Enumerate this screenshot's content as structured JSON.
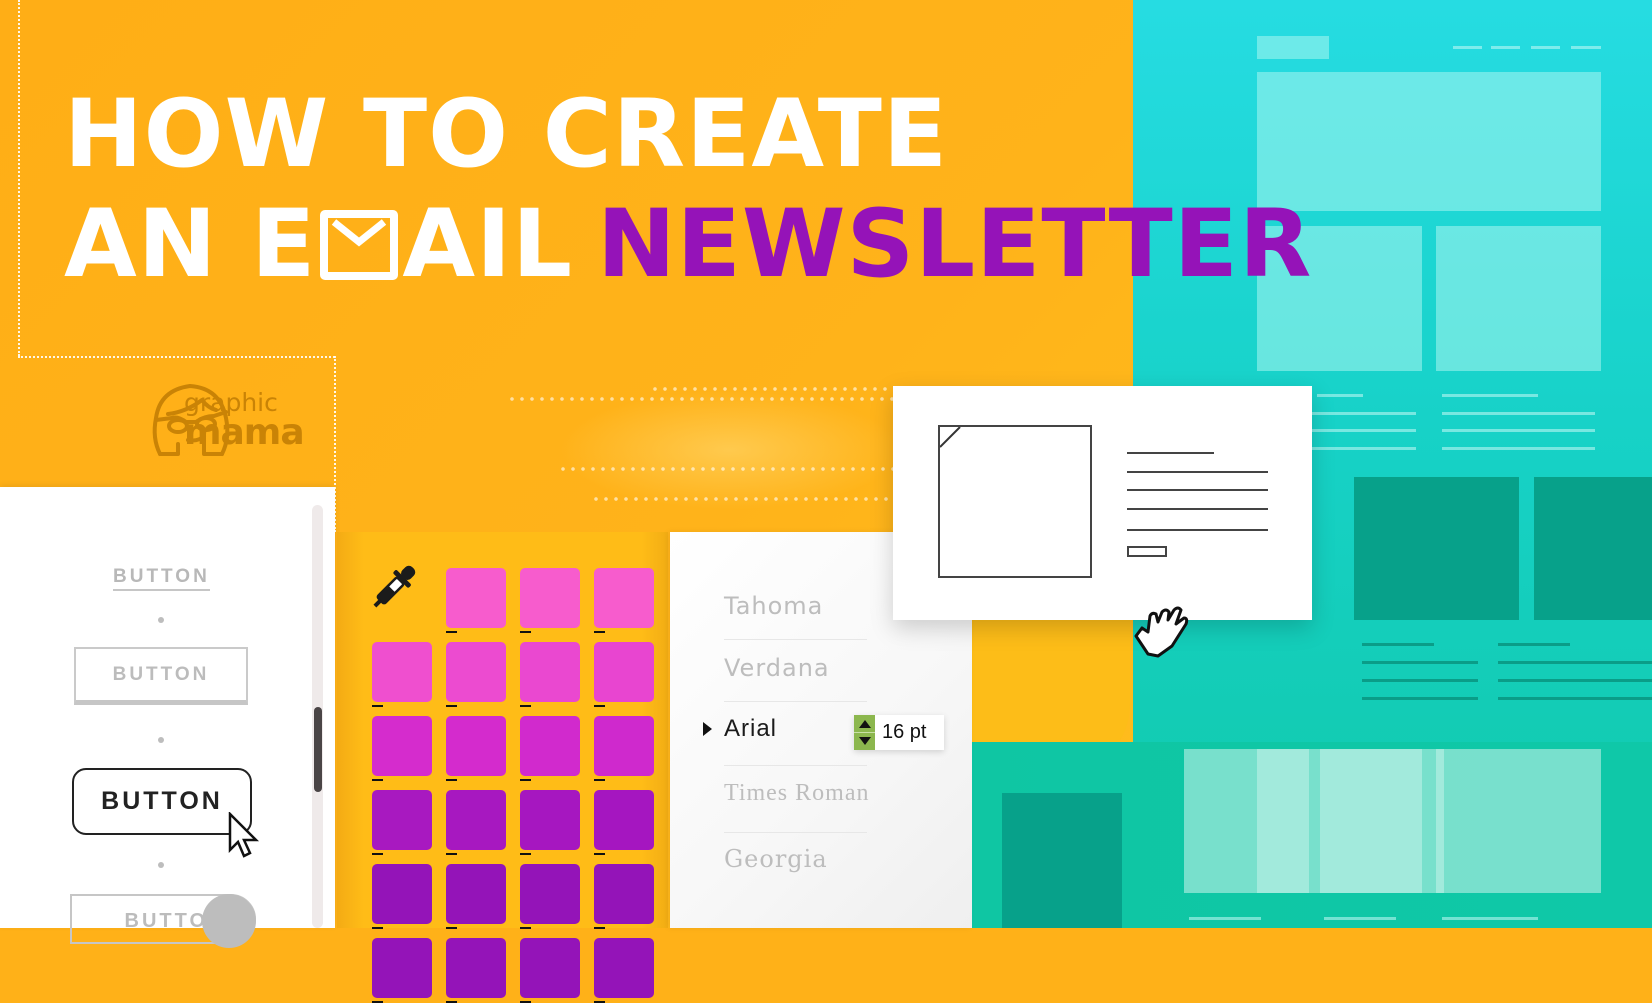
{
  "title": {
    "line1": "HOW TO CREATE",
    "line2_prefix_a": "AN E",
    "line2_mail_icon": "envelope-icon",
    "line2_prefix_b": "AIL",
    "line2_accent": "NEWSLETTER"
  },
  "brand": {
    "logo_icon": "woman-with-glasses-icon",
    "name_top": "graphic",
    "name_bottom": "mama"
  },
  "colors": {
    "orange": "#ffb118",
    "teal": "#17d2c8",
    "purple_accent": "#9513b8",
    "stepper_green": "#8cb74e"
  },
  "button_styles": {
    "items": [
      {
        "label": "BUTTON",
        "style": "text-link"
      },
      {
        "label": "BUTTON",
        "style": "outline"
      },
      {
        "label": "BUTTON",
        "style": "rounded-active"
      },
      {
        "label": "BUTTON",
        "style": "toggle"
      }
    ]
  },
  "color_picker": {
    "eyedropper_icon": "eyedropper-icon",
    "swatches": [
      [
        "",
        "#f75ccd",
        "#f75ccd",
        "#f75ccd"
      ],
      [
        "#ef4fcf",
        "#ec4bd0",
        "#ea48d0",
        "#e845d0"
      ],
      [
        "#d52ccd",
        "#d42bcd",
        "#d12acd",
        "#cf29cd"
      ],
      [
        "#a819c0",
        "#a718c0",
        "#a617c0",
        "#a516c0"
      ],
      [
        "#9414b8",
        "#9414b8",
        "#9414b8",
        "#9414b8"
      ],
      [
        "#9414b8",
        "#9414b8",
        "#9414b8",
        "#9414b8"
      ]
    ]
  },
  "font_list": {
    "fonts": [
      "Tahoma",
      "Verdana",
      "Arial",
      "Times Roman",
      "Georgia"
    ],
    "selected": "Arial",
    "size": "16 pt"
  }
}
